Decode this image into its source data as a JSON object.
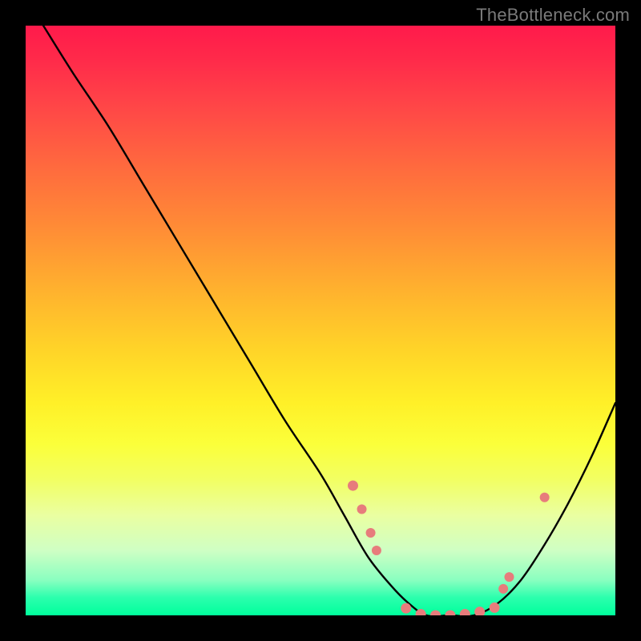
{
  "watermark": "TheBottleneck.com",
  "chart_data": {
    "type": "line",
    "title": "",
    "xlabel": "",
    "ylabel": "",
    "xlim": [
      0,
      100
    ],
    "ylim": [
      0,
      100
    ],
    "grid": false,
    "series": [
      {
        "name": "curve",
        "x": [
          3,
          8,
          14,
          20,
          26,
          32,
          38,
          44,
          50,
          54,
          58,
          62,
          65,
          68,
          72,
          76,
          80,
          84,
          88,
          92,
          96,
          100
        ],
        "y": [
          100,
          92,
          83,
          73,
          63,
          53,
          43,
          33,
          24,
          17,
          10,
          5,
          2,
          0,
          0,
          0,
          2,
          6,
          12,
          19,
          27,
          36
        ]
      }
    ],
    "markers": [
      {
        "x": 55.5,
        "y": 22,
        "r": 6.5
      },
      {
        "x": 57.0,
        "y": 18,
        "r": 6.0
      },
      {
        "x": 58.5,
        "y": 14,
        "r": 6.0
      },
      {
        "x": 59.5,
        "y": 11,
        "r": 6.0
      },
      {
        "x": 64.5,
        "y": 1.2,
        "r": 6.5
      },
      {
        "x": 67.0,
        "y": 0.2,
        "r": 6.5
      },
      {
        "x": 69.5,
        "y": 0.0,
        "r": 6.5
      },
      {
        "x": 72.0,
        "y": 0.0,
        "r": 6.5
      },
      {
        "x": 74.5,
        "y": 0.2,
        "r": 6.5
      },
      {
        "x": 77.0,
        "y": 0.6,
        "r": 6.5
      },
      {
        "x": 79.5,
        "y": 1.3,
        "r": 6.5
      },
      {
        "x": 81.0,
        "y": 4.5,
        "r": 6.0
      },
      {
        "x": 82.0,
        "y": 6.5,
        "r": 6.0
      },
      {
        "x": 88.0,
        "y": 20,
        "r": 6.0
      }
    ],
    "colors": {
      "curve": "#000000",
      "marker_fill": "#e77c7c",
      "marker_stroke": "#d65e5e"
    }
  }
}
